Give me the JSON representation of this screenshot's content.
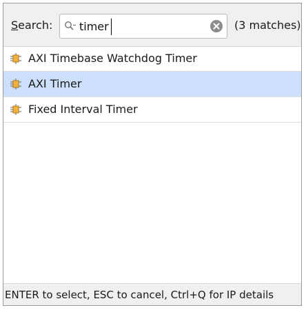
{
  "search": {
    "label_first": "S",
    "label_rest": "earch:",
    "value": "timer",
    "match_count": "(3 matches)",
    "clear_icon": "clear-circle-icon",
    "search_icon": "search-icon"
  },
  "results": [
    {
      "label": "AXI Timebase Watchdog Timer",
      "icon": "ip-core-icon",
      "selected": false
    },
    {
      "label": "AXI Timer",
      "icon": "ip-core-icon",
      "selected": true
    },
    {
      "label": "Fixed Interval Timer",
      "icon": "ip-core-icon",
      "selected": false
    }
  ],
  "footer": {
    "hint": "ENTER to select, ESC to cancel, Ctrl+Q for IP details"
  },
  "colors": {
    "selection": "#cde0fb",
    "icon_orange": "#f0a020",
    "panel_bg": "#f0f0f0"
  }
}
